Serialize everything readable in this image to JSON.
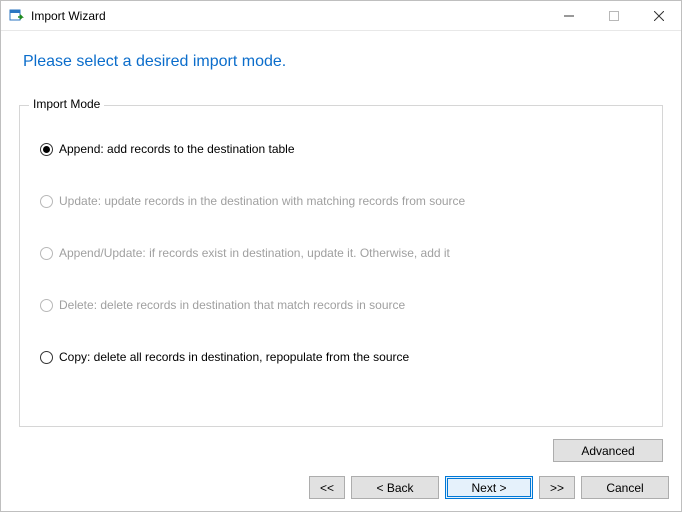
{
  "window": {
    "title": "Import Wizard"
  },
  "heading": "Please select a desired import mode.",
  "group": {
    "legend": "Import Mode"
  },
  "options": {
    "append": {
      "label": "Append: add records to the destination table",
      "selected": true,
      "enabled": true
    },
    "update": {
      "label": "Update: update records in the destination with matching records from source",
      "selected": false,
      "enabled": false
    },
    "append_update": {
      "label": "Append/Update: if records exist in destination, update it. Otherwise, add it",
      "selected": false,
      "enabled": false
    },
    "delete": {
      "label": "Delete: delete records in destination that match records in source",
      "selected": false,
      "enabled": false
    },
    "copy": {
      "label": "Copy: delete all records in destination, repopulate from the source",
      "selected": false,
      "enabled": true
    }
  },
  "buttons": {
    "advanced": "Advanced",
    "first": "<<",
    "back": "< Back",
    "next": "Next >",
    "last": ">>",
    "cancel": "Cancel"
  }
}
